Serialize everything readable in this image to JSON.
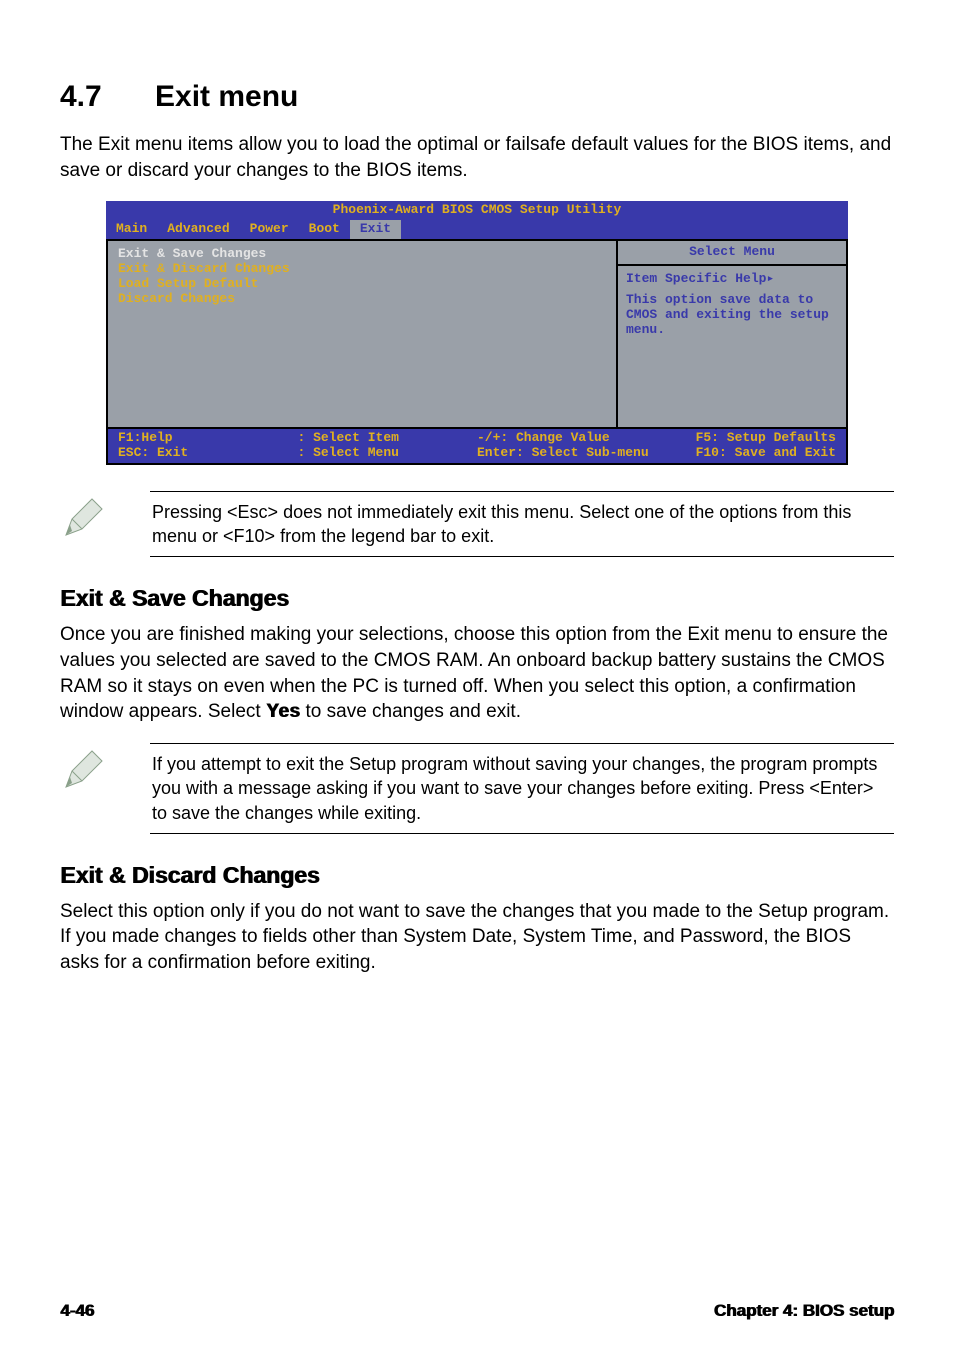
{
  "section": {
    "number": "4.7",
    "title": "Exit menu"
  },
  "intro": "The Exit menu items allow you to load the optimal or failsafe default values for the BIOS items, and save or discard your changes to the BIOS items.",
  "bios": {
    "title": "Phoenix-Award BIOS CMOS Setup Utility",
    "tabs": [
      "Main",
      "Advanced",
      "Power",
      "Boot",
      "Exit"
    ],
    "active_tab_index": 4,
    "left_items": [
      "Exit & Save Changes",
      "Exit & Discard Changes",
      "Load Setup Default",
      "Discard Changes"
    ],
    "selected_index": 0,
    "right": {
      "head": "Select Menu",
      "help_label": "Item Specific Help",
      "help_arrow": "▸",
      "help_text": "This option save data to CMOS and exiting the setup menu."
    },
    "footer": {
      "l1a": "F1:Help",
      "l1b": ": Select Item",
      "l1c": "-/+: Change Value",
      "l1d": "F5: Setup Defaults",
      "l2a": "ESC: Exit",
      "l2b": ": Select Menu",
      "l2c": "Enter: Select Sub-menu",
      "l2d": "F10: Save and Exit"
    }
  },
  "note1": "Pressing <Esc> does not immediately exit this menu. Select one of the options from this menu or <F10> from the legend bar to exit.",
  "sub1": {
    "head": "Exit & Save Changes",
    "body_before_yes": "Once you are finished making your selections, choose this option from the Exit menu to ensure the values you selected are saved to the CMOS RAM. An onboard backup battery sustains the CMOS RAM so it stays on even when the PC is turned off. When you select this option, a confirmation window appears. Select ",
    "yes": "Yes",
    "body_after_yes": " to save changes and exit."
  },
  "note2": " If you attempt to exit the Setup program without saving your changes, the program prompts you with a message asking if you want to save your changes before exiting. Press <Enter>  to save the  changes while exiting.",
  "sub2": {
    "head": "Exit & Discard Changes",
    "body": "Select this option only if you do not want to save the changes that you made to the Setup program. If you made changes to fields other than System Date, System Time, and Password, the BIOS asks for a confirmation before exiting."
  },
  "footer": {
    "left": "4-46",
    "right": "Chapter 4: BIOS setup"
  }
}
